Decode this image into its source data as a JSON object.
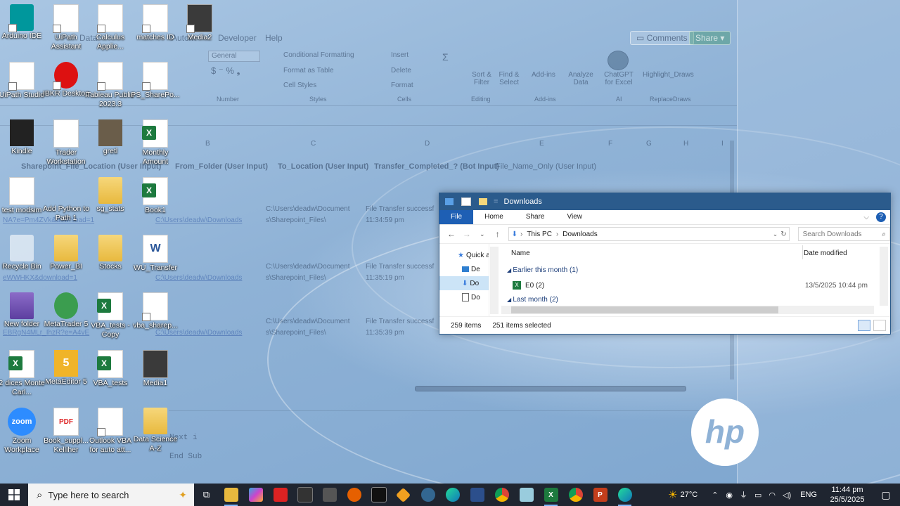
{
  "excel_ghost": {
    "tabs": [
      "Developer",
      "Help"
    ],
    "tab_fragments": [
      "Data",
      "Autom"
    ],
    "comments": "Comments",
    "share": "Share",
    "number_format": "General",
    "cond_format": "Conditional Formatting",
    "format_table": "Format as Table",
    "cell_styles": "Cell Styles",
    "insert": "Insert",
    "delete": "Delete",
    "format": "Format",
    "sort_filter": "Sort & Filter",
    "find_select": "Find & Select",
    "add_ins": "Add-ins",
    "analyze_data": "Analyze Data",
    "chatgpt": "ChatGPT for Excel",
    "highlight_draws": "Highlight_Draws",
    "groups": [
      "Number",
      "Styles",
      "Cells",
      "Editing",
      "Add-ins",
      "AI",
      "ReplaceDraws"
    ],
    "columns": [
      "B",
      "C",
      "D",
      "E",
      "F",
      "G",
      "H",
      "I"
    ],
    "headers": [
      "Sharepoint_File_Location (User Input)",
      "From_Folder (User Input)",
      "To_Location (User Input)",
      "Transfer_Completed_? (Bot Input)",
      "File_Name_Only (User Input)"
    ],
    "rows": [
      {
        "link_a": "NA?e=Pm4ZVk&download=1",
        "link_b": "C:\\Users\\deadw\\Downloads",
        "to1": "C:\\Users\\deadw\\Document",
        "to2": "s\\Sharepoint_Files\\",
        "status": "File Transfer successf",
        "time": "11:34:59 pm"
      },
      {
        "link_a": "eWWHKX&download=1",
        "link_b": "C:\\Users\\deadw\\Downloads",
        "to1": "C:\\Users\\deadw\\Document",
        "to2": "s\\Sharepoint_Files\\",
        "status": "File Transfer successf",
        "time": "11:35:19 pm"
      },
      {
        "link_a": "EBRgN4MLr_IhzR?e=A4vE",
        "link_b": "C:\\Users\\deadw\\Downloads",
        "to1": "C:\\Users\\deadw\\Document",
        "to2": "s\\Sharepoint_Files\\",
        "status": "File Transfer successf",
        "time": "11:35:39 pm"
      }
    ],
    "code_next": "Next i",
    "code_end": "End Sub"
  },
  "desktop_icons": [
    {
      "label": "Arduino IDE"
    },
    {
      "label": "UiPath Assistant"
    },
    {
      "label": "Calculus Applie..."
    },
    {
      "label": "matches ID"
    },
    {
      "label": "Media2"
    },
    {
      "label": "UiPath Studio"
    },
    {
      "label": "IBKR Desktop"
    },
    {
      "label": "Tableau Public 2023.3"
    },
    {
      "label": "PS_SharePo..."
    },
    {
      "label": "Kindle"
    },
    {
      "label": "Trader Workstation"
    },
    {
      "label": "gretl"
    },
    {
      "label": "Monthly Amount"
    },
    {
      "label": "test modsim"
    },
    {
      "label": "Add Python to Path 1"
    },
    {
      "label": "sg_stats"
    },
    {
      "label": "Book1"
    },
    {
      "label": "Recycle Bin"
    },
    {
      "label": "Power_BI"
    },
    {
      "label": "Stocks"
    },
    {
      "label": "WU_Transfer"
    },
    {
      "label": "New folder"
    },
    {
      "label": "MetaTrader 5"
    },
    {
      "label": "VBA_tests - Copy"
    },
    {
      "label": "vba_sharep..."
    },
    {
      "label": "2 dices Monte Carl..."
    },
    {
      "label": "MetaEditor 5"
    },
    {
      "label": "VBA_tests"
    },
    {
      "label": "Media1"
    },
    {
      "label": "Zoom Workplace"
    },
    {
      "label": "Book_suppl... Kelliher"
    },
    {
      "label": "Outlook VBA for auto att..."
    },
    {
      "label": "Data Science A-Z"
    }
  ],
  "icon_glyphs": {
    "zoom": "zoom",
    "pdf": "PDF",
    "word": "W",
    "five": "5",
    "hp": "hp"
  },
  "explorer": {
    "title": "Downloads",
    "ribbon_tabs": [
      "File",
      "Home",
      "Share",
      "View"
    ],
    "breadcrumb": [
      "This PC",
      "Downloads"
    ],
    "search_placeholder": "Search Downloads",
    "nav_items": [
      "Quick a",
      "De",
      "Do",
      "Do"
    ],
    "columns": {
      "name": "Name",
      "date": "Date modified"
    },
    "groups": [
      {
        "label": "Earlier this month (1)",
        "files": [
          {
            "name": "E0 (2)",
            "date": "13/5/2025 10:44 pm"
          }
        ]
      },
      {
        "label": "Last month (2)",
        "files": []
      }
    ],
    "status_items": "259 items",
    "status_selected": "251 items selected"
  },
  "taskbar": {
    "search_placeholder": "Type here to search",
    "weather": "27°C",
    "language": "ENG",
    "time": "11:44 pm",
    "date": "25/5/2025"
  },
  "colors": {
    "taskbar": "#1f2530",
    "explorer_title": "#2b5b8c",
    "accent": "#1e5fb4",
    "excel_green": "#1d7a3e"
  }
}
